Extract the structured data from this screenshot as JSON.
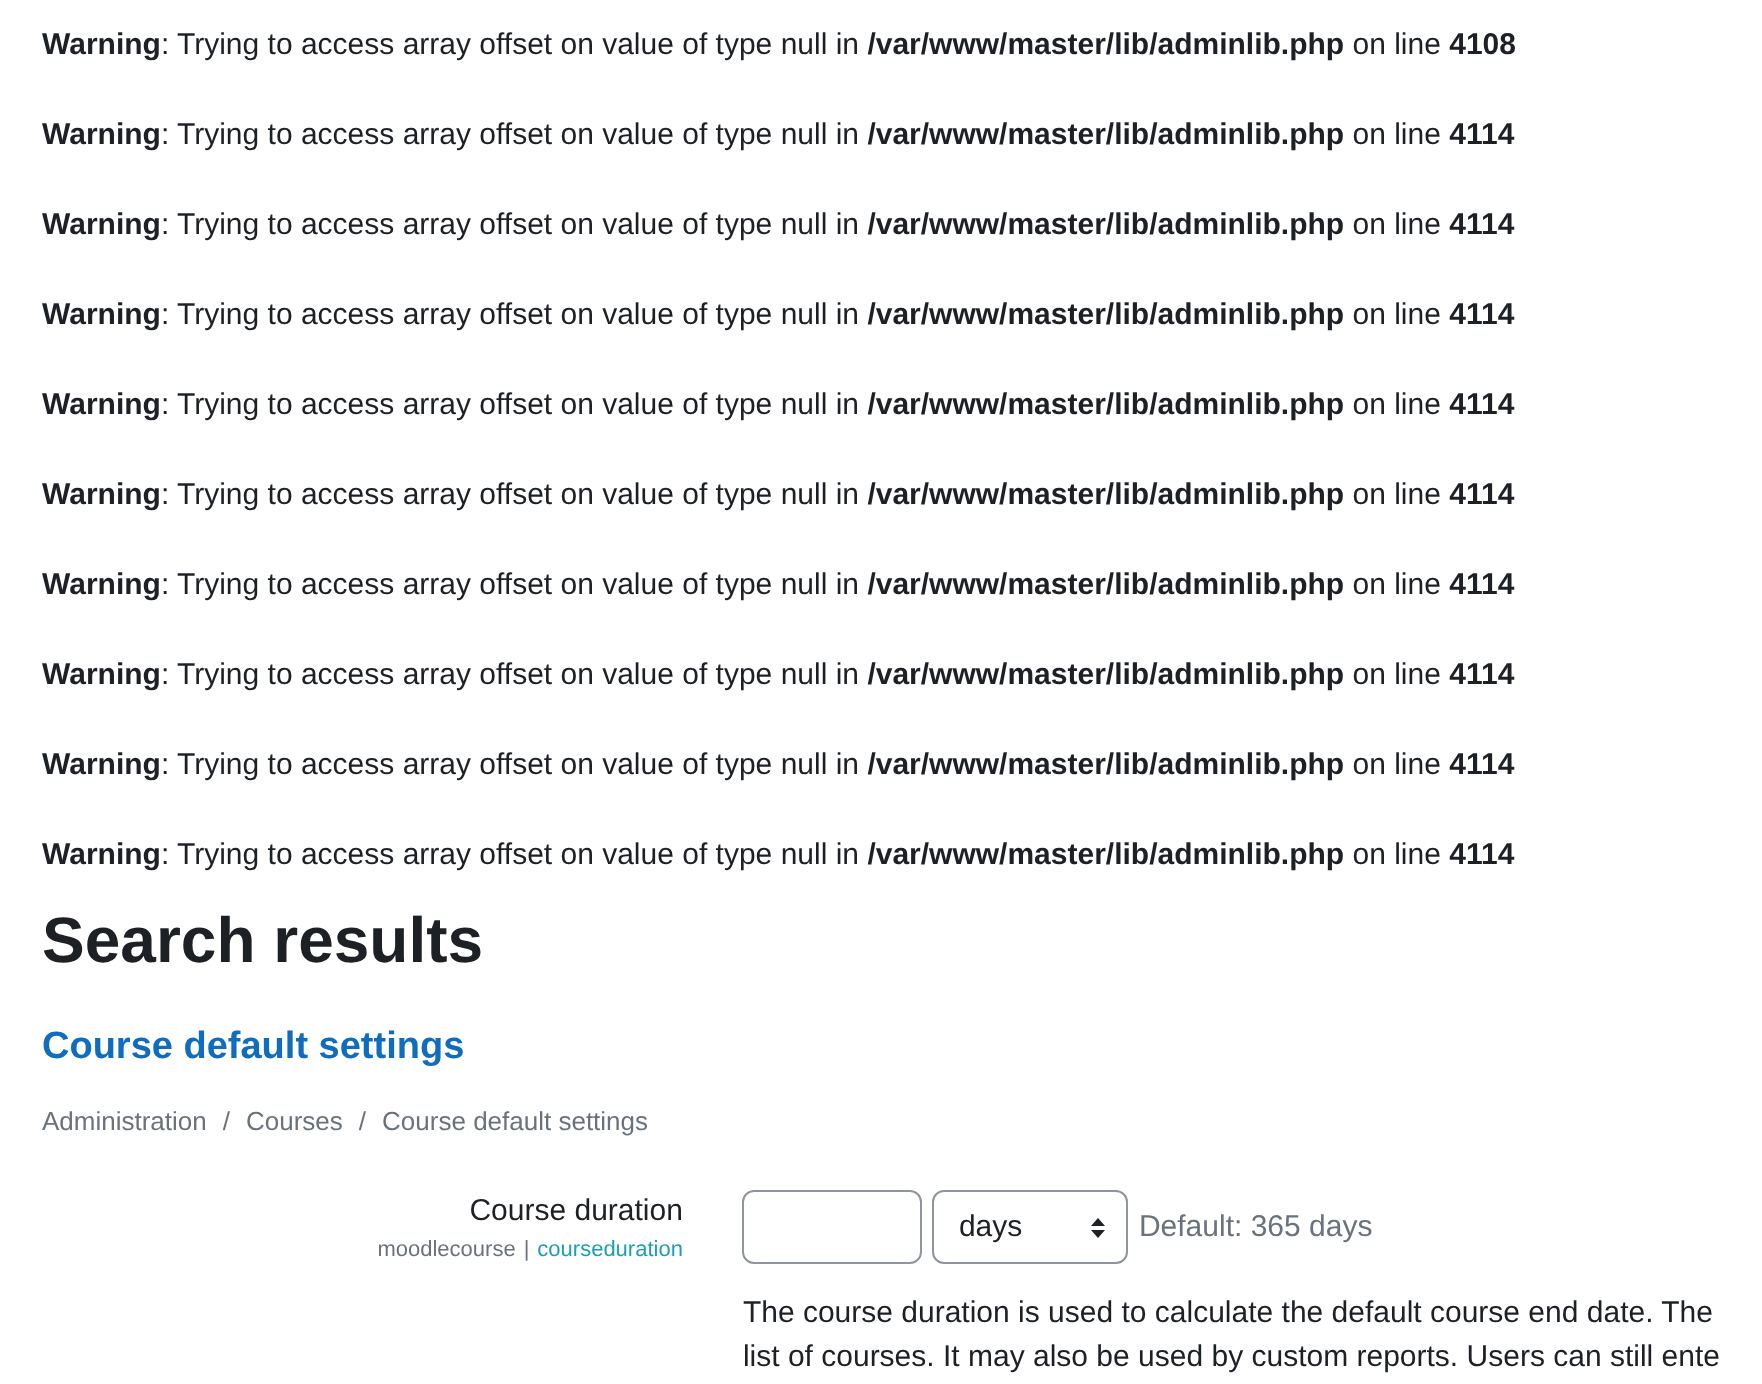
{
  "warnings": [
    "**Warning**: Trying to access array offset on value of type null in **/var/www/master/lib/adminlib.php** on line **4108**",
    "**Warning**: Trying to access array offset on value of type null in **/var/www/master/lib/adminlib.php** on line **4114**",
    "**Warning**: Trying to access array offset on value of type null in **/var/www/master/lib/adminlib.php** on line **4114**",
    "**Warning**: Trying to access array offset on value of type null in **/var/www/master/lib/adminlib.php** on line **4114**",
    "**Warning**: Trying to access array offset on value of type null in **/var/www/master/lib/adminlib.php** on line **4114**",
    "**Warning**: Trying to access array offset on value of type null in **/var/www/master/lib/adminlib.php** on line **4114**",
    "**Warning**: Trying to access array offset on value of type null in **/var/www/master/lib/adminlib.php** on line **4114**",
    "**Warning**: Trying to access array offset on value of type null in **/var/www/master/lib/adminlib.php** on line **4114**",
    "**Warning**: Trying to access array offset on value of type null in **/var/www/master/lib/adminlib.php** on line **4114**",
    "**Warning**: Trying to access array offset on value of type null in **/var/www/master/lib/adminlib.php** on line **4114**"
  ],
  "page_title": "Search results",
  "section_link": "Course default settings",
  "breadcrumb": [
    "Administration",
    "Courses",
    "Course default settings"
  ],
  "breadcrumb_separator": "/",
  "setting": {
    "label": "Course duration",
    "component": "moodlecourse",
    "separator": "|",
    "name_link": "courseduration",
    "unit": "days",
    "default": "Default: 365 days",
    "description_lines": [
      "The course duration is used to calculate the default course end date. The",
      "list of courses. It may also be used by custom reports. Users can still ente"
    ]
  }
}
